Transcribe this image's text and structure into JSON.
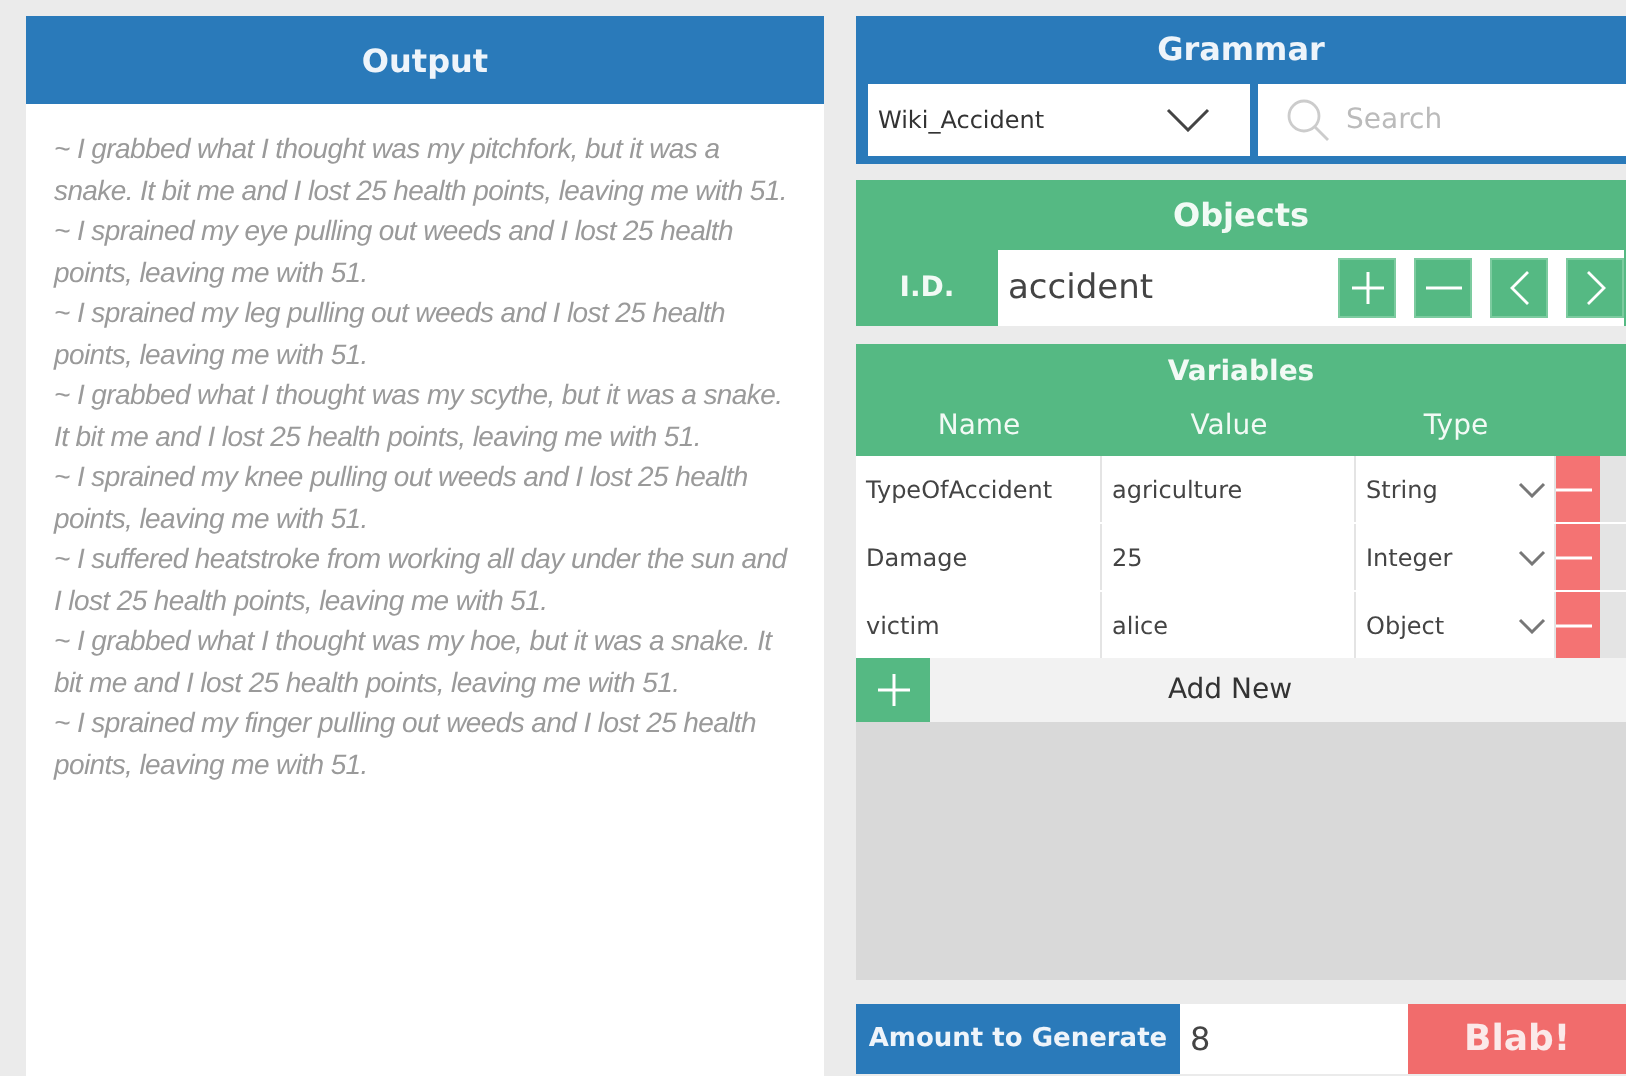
{
  "output": {
    "title": "Output",
    "lines": [
      "~  I grabbed what I thought was my pitchfork, but it was a snake. It bit me and I lost 25 health points, leaving me with 51.",
      "~  I sprained my eye pulling out weeds and I lost 25 health points, leaving me with 51.",
      "~  I sprained my leg pulling out weeds and I lost 25 health points, leaving me with 51.",
      "~  I grabbed what I thought was my scythe, but it was a snake. It bit me and I lost 25 health points, leaving me with 51.",
      "~  I sprained my knee pulling out weeds and I lost 25 health points, leaving me with 51.",
      "~  I suffered heatstroke from working all day under the sun and I lost 25 health points, leaving me with 51.",
      "~  I grabbed what I thought was my hoe, but it was a snake. It bit me and I lost 25 health points, leaving me with 51.",
      "~  I sprained my finger pulling out weeds and I lost 25 health points, leaving me with 51."
    ]
  },
  "grammar": {
    "title": "Grammar",
    "selected": "Wiki_Accident",
    "search": {
      "placeholder": "Search"
    }
  },
  "objects": {
    "title": "Objects",
    "id_label": "I.D.",
    "id_value": "accident"
  },
  "variables": {
    "title": "Variables",
    "columns": [
      "Name",
      "Value",
      "Type"
    ],
    "rows": [
      {
        "name": "TypeOfAccident",
        "value": "agriculture",
        "type": "String"
      },
      {
        "name": "Damage",
        "value": "25",
        "type": "Integer"
      },
      {
        "name": "victim",
        "value": "alice",
        "type": "Object"
      }
    ],
    "add_label": "Add New"
  },
  "generate": {
    "label": "Amount to Generate",
    "amount": "8",
    "button": "Blab!"
  }
}
